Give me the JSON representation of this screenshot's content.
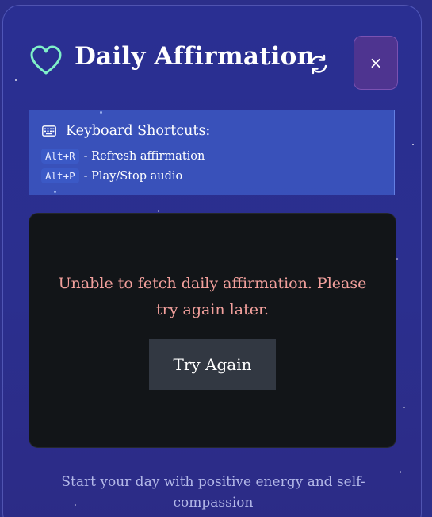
{
  "header": {
    "title": "Daily Affirmation",
    "refresh_icon": "refresh-icon",
    "close_label": "×",
    "heart_icon": "heart-icon",
    "heart_color": "#7ff0c8"
  },
  "shortcuts": {
    "title": "Keyboard Shortcuts:",
    "icon": "keyboard-icon",
    "items": [
      {
        "key": "Alt+R",
        "description": "- Refresh affirmation"
      },
      {
        "key": "Alt+P",
        "description": "- Play/Stop audio"
      }
    ]
  },
  "error": {
    "message": "Unable to fetch daily affirmation. Please try again later.",
    "button_label": "Try Again",
    "color": "#f2a09c"
  },
  "tagline": "Start your day with positive energy and self-compassion",
  "colors": {
    "background": "#2a2f92",
    "close_button": "#4e3490",
    "card": "#121518",
    "button": "#323842"
  }
}
